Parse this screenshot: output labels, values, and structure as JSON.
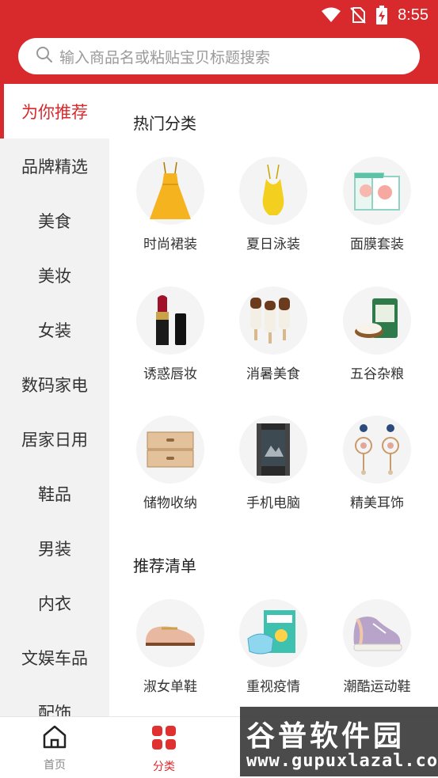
{
  "status_bar": {
    "time": "8:55",
    "icons": [
      "wifi-icon",
      "no-sim-icon",
      "battery-charging-icon"
    ]
  },
  "search": {
    "placeholder": "输入商品名或粘贴宝贝标题搜索",
    "icon": "search-icon"
  },
  "sidebar": {
    "items": [
      {
        "label": "为你推荐",
        "active": true
      },
      {
        "label": "品牌精选"
      },
      {
        "label": "美食"
      },
      {
        "label": "美妆"
      },
      {
        "label": "女装"
      },
      {
        "label": "数码家电"
      },
      {
        "label": "居家日用"
      },
      {
        "label": "鞋品"
      },
      {
        "label": "男装"
      },
      {
        "label": "内衣"
      },
      {
        "label": "文娱车品"
      },
      {
        "label": "配饰"
      }
    ]
  },
  "main": {
    "hot_title": "热门分类",
    "hot_items": [
      {
        "label": "时尚裙装",
        "icon": "dress-icon"
      },
      {
        "label": "夏日泳装",
        "icon": "swimsuit-icon"
      },
      {
        "label": "面膜套装",
        "icon": "facemask-box-icon"
      },
      {
        "label": "诱惑唇妆",
        "icon": "lipstick-icon"
      },
      {
        "label": "消暑美食",
        "icon": "popsicle-icon"
      },
      {
        "label": "五谷杂粮",
        "icon": "rice-bag-icon"
      },
      {
        "label": "储物收纳",
        "icon": "drawer-box-icon"
      },
      {
        "label": "手机电脑",
        "icon": "rugged-phone-icon"
      },
      {
        "label": "精美耳饰",
        "icon": "earrings-icon"
      }
    ],
    "rec_title": "推荐清单",
    "rec_items": [
      {
        "label": "淑女单鞋",
        "icon": "loafer-icon"
      },
      {
        "label": "重视疫情",
        "icon": "medical-mask-icon"
      },
      {
        "label": "潮酷运动鞋",
        "icon": "sneaker-icon"
      }
    ]
  },
  "tabbar": {
    "tabs": [
      {
        "label": "首页",
        "icon": "home-icon",
        "active": false
      },
      {
        "label": "分类",
        "icon": "category-grid-icon",
        "active": true
      }
    ]
  },
  "watermark": {
    "line1": "谷普软件园",
    "line2": "www.gupuxlazal.com"
  },
  "colors": {
    "brand_red": "#d8292d",
    "sidebar_bg": "#f2f2f2",
    "thumb_bg": "#f4f4f4"
  }
}
